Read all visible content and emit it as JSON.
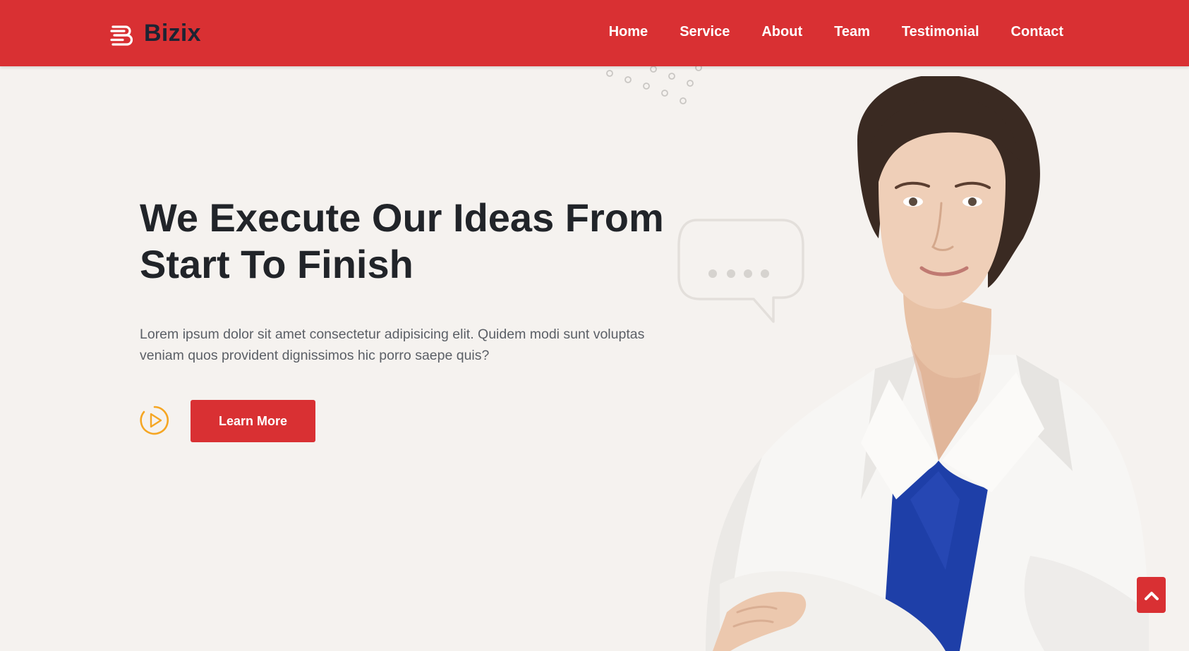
{
  "brand": {
    "name": "Bizix"
  },
  "nav": {
    "items": [
      {
        "label": "Home"
      },
      {
        "label": "Service"
      },
      {
        "label": "About"
      },
      {
        "label": "Team"
      },
      {
        "label": "Testimonial"
      },
      {
        "label": "Contact"
      }
    ]
  },
  "hero": {
    "title_line1": "We Execute Our Ideas From",
    "title_line2": "Start To Finish",
    "description": "Lorem ipsum dolor sit amet consectetur adipisicing elit. Quidem modi sunt voluptas veniam quos provident dignissimos hic porro saepe quis?",
    "cta_label": "Learn More"
  },
  "icons": {
    "logo": "logo-icon",
    "play": "play-circle-icon",
    "scroll_top": "chevron-up-icon",
    "bubble": "speech-bubble-icon"
  },
  "colors": {
    "primary": "#d93033",
    "background": "#f5f2ef",
    "heading": "#212429",
    "text": "#5b5f66",
    "play_accent": "#f5a623",
    "logo_text": "#1d2433"
  }
}
